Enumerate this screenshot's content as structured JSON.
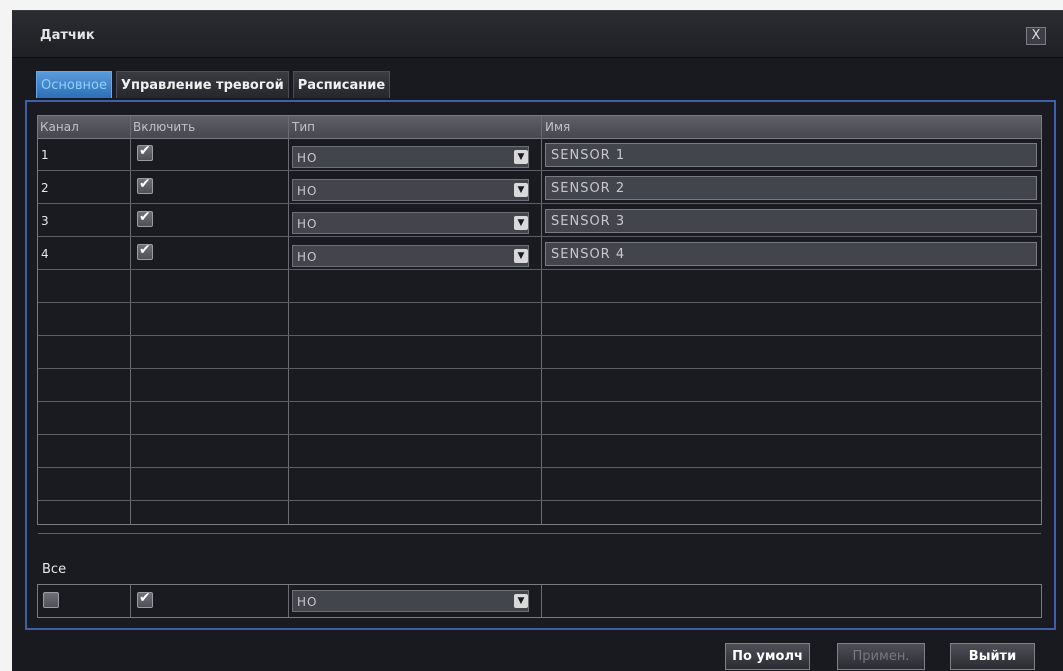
{
  "window": {
    "title": "Датчик",
    "close_label": "X"
  },
  "tabs": [
    {
      "label": "Основное",
      "active": true
    },
    {
      "label": "Управление тревогой",
      "active": false
    },
    {
      "label": "Расписание",
      "active": false
    }
  ],
  "table": {
    "headers": {
      "channel": "Канал",
      "enable": "Включить",
      "type": "Тип",
      "name": "Имя"
    },
    "rows": [
      {
        "channel": "1",
        "enabled": true,
        "type": "НО",
        "name": "SENSOR 1"
      },
      {
        "channel": "2",
        "enabled": true,
        "type": "НО",
        "name": "SENSOR 2"
      },
      {
        "channel": "3",
        "enabled": true,
        "type": "НО",
        "name": "SENSOR 3"
      },
      {
        "channel": "4",
        "enabled": true,
        "type": "НО",
        "name": "SENSOR 4"
      }
    ]
  },
  "all": {
    "label": "Все",
    "select_checked": false,
    "enabled": true,
    "type": "НО"
  },
  "buttons": {
    "default": "По умолч",
    "apply": "Примен.",
    "exit": "Выйти"
  },
  "colors": {
    "accent": "#3f5fa8",
    "tab_active": "#2d6fb7",
    "background": "#191a1f"
  }
}
